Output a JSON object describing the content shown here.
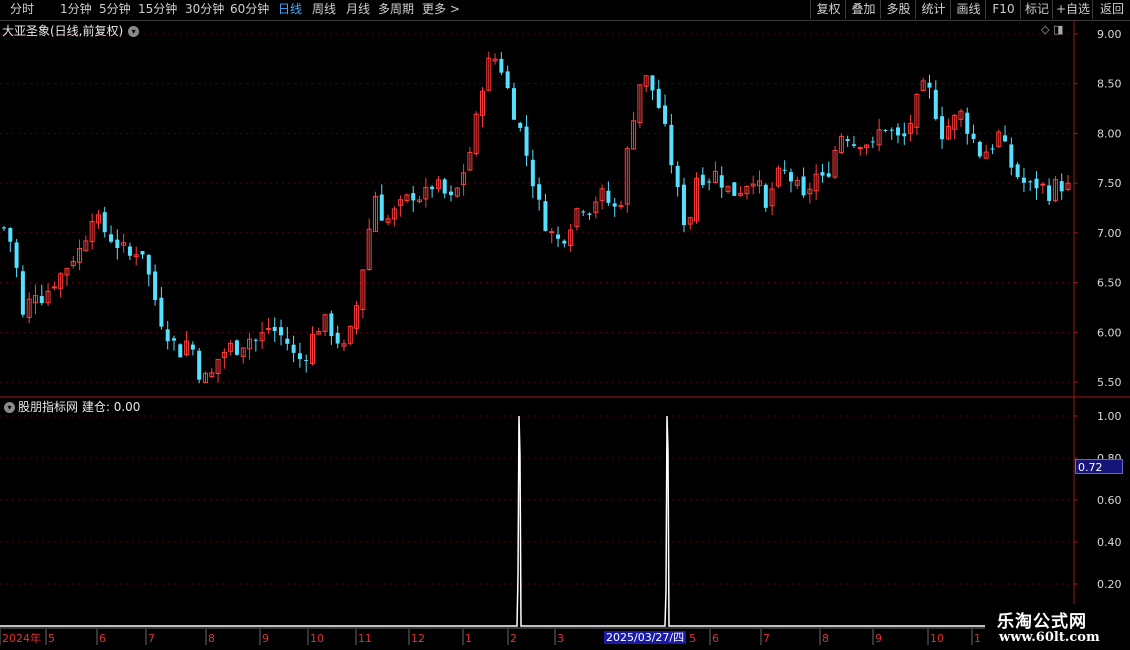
{
  "toolbar": {
    "period_tabs": [
      "分时",
      "1分钟",
      "5分钟",
      "15分钟",
      "30分钟",
      "60分钟",
      "日线",
      "周线",
      "月线",
      "多周期",
      "更多 >"
    ],
    "active_tab": "日线",
    "right_buttons": [
      "复权",
      "叠加",
      "多股",
      "统计",
      "画线",
      "F10",
      "标记",
      "+自选",
      "返回"
    ]
  },
  "main_chart": {
    "title": "大亚圣象(日线,前复权)",
    "y_ticks": [
      "9.00",
      "8.50",
      "8.00",
      "7.50",
      "7.00",
      "6.50",
      "6.00",
      "5.50"
    ],
    "x_labels": [
      "2024年",
      "5",
      "6",
      "7",
      "8",
      "9",
      "10",
      "11",
      "12",
      "1",
      "2",
      "3",
      "4",
      "5",
      "6",
      "7",
      "8",
      "9",
      "10",
      "1"
    ],
    "cursor_date": "2025/03/27/四"
  },
  "indicator": {
    "title": "股朋指标网",
    "line_label": "建仓",
    "line_value": "0.00",
    "y_ticks": [
      "1.00",
      "0.80",
      "0.60",
      "0.40",
      "0.20"
    ],
    "cursor_value": "0.72"
  },
  "watermark": {
    "line1": "乐淘公式网",
    "line2": "www.60lt.com"
  },
  "colors": {
    "up": "#ff3c3c",
    "down": "#55e0ff",
    "grid": "#5a0000",
    "axis": "#a01818",
    "signal": "#ffffff"
  },
  "chart_data": {
    "type": "candlestick",
    "title": "大亚圣象(日线,前复权)",
    "x_range": [
      "2024-04",
      "2025-10"
    ],
    "ylim": [
      5.35,
      9.1
    ],
    "close_path": [
      7.05,
      6.85,
      6.1,
      6.45,
      6.35,
      6.5,
      6.6,
      6.75,
      6.85,
      7.2,
      7.05,
      6.95,
      6.85,
      6.75,
      6.9,
      6.5,
      6.15,
      5.95,
      5.8,
      5.95,
      5.6,
      5.5,
      5.75,
      5.85,
      5.85,
      5.95,
      5.9,
      6.05,
      6.0,
      5.9,
      5.7,
      5.8,
      6.05,
      6.1,
      5.95,
      5.8,
      6.2,
      6.8,
      7.4,
      7.1,
      7.2,
      7.3,
      7.4,
      7.35,
      7.5,
      7.4,
      7.3,
      7.6,
      7.9,
      8.5,
      8.8,
      8.65,
      8.3,
      8.0,
      7.6,
      7.2,
      7.0,
      6.9,
      7.1,
      7.3,
      7.25,
      7.4,
      7.3,
      7.2,
      7.9,
      8.5,
      8.55,
      8.3,
      7.9,
      7.4,
      7.0,
      7.6,
      7.55,
      7.6,
      7.45,
      7.4,
      7.5,
      7.6,
      7.2,
      7.55,
      7.6,
      7.5,
      7.3,
      7.6,
      7.5,
      7.8,
      8.05,
      7.9,
      7.95,
      7.85,
      8.1,
      8.0,
      7.9,
      8.15,
      8.45,
      8.4,
      8.0,
      8.1,
      8.2,
      8.0,
      7.8,
      7.85,
      8.0,
      7.7,
      7.55,
      7.45,
      7.5,
      7.4,
      7.5,
      7.45
    ],
    "signal_series": {
      "name": "建仓",
      "ylim": [
        0,
        1.05
      ],
      "spikes": [
        {
          "date": "2025-02",
          "value": 1.0
        },
        {
          "date": "2025-03-27",
          "value": 1.0
        }
      ],
      "baseline": 0.0
    }
  }
}
